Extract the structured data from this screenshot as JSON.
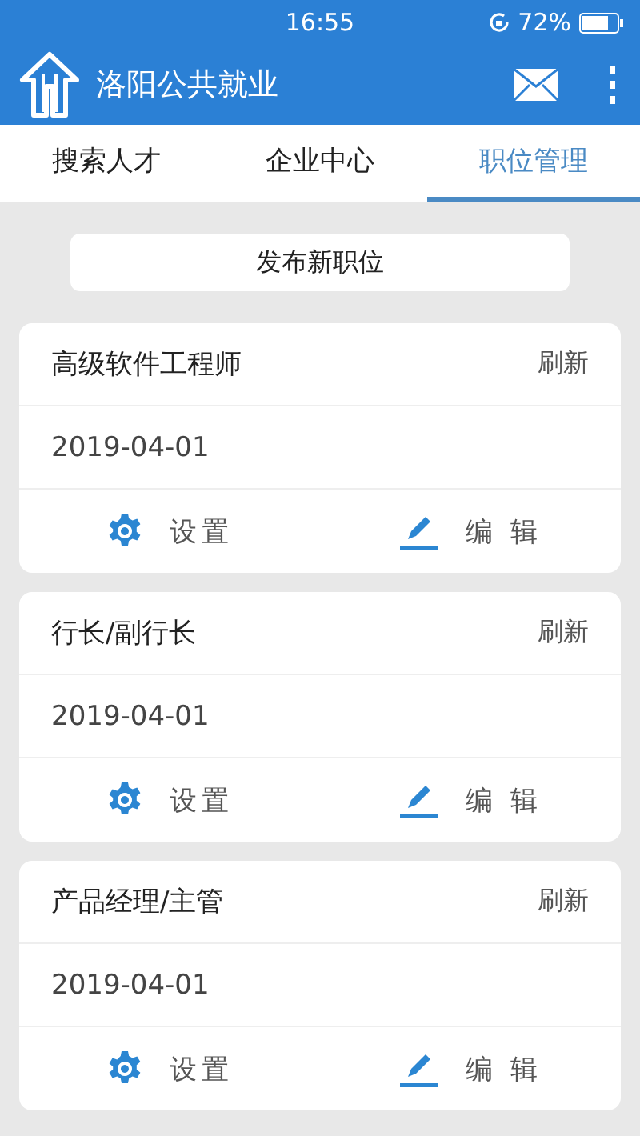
{
  "status_bar": {
    "time": "16:55",
    "battery": "72%"
  },
  "app_bar": {
    "title": "洛阳公共就业"
  },
  "tabs": [
    {
      "label": "搜索人才",
      "selected": false
    },
    {
      "label": "企业中心",
      "selected": false
    },
    {
      "label": "职位管理",
      "selected": true
    }
  ],
  "publish_button": "发布新职位",
  "jobs": [
    {
      "title": "高级软件工程师",
      "refresh": "刷新",
      "date": "2019-04-01",
      "actions": [
        "设置",
        "编 辑"
      ]
    },
    {
      "title": "行长/副行长",
      "refresh": "刷新",
      "date": "2019-04-01",
      "actions": [
        "设置",
        "编 辑"
      ]
    },
    {
      "title": "产品经理/主管",
      "refresh": "刷新",
      "date": "2019-04-01",
      "actions": [
        "设置",
        "编 辑"
      ]
    }
  ]
}
